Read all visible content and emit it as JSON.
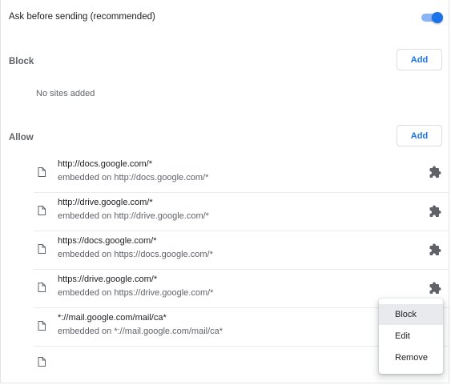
{
  "toggle_row": {
    "label": "Ask before sending (recommended)",
    "enabled": true,
    "accent_color": "#1a73e8"
  },
  "block_section": {
    "title": "Block",
    "add_label": "Add",
    "empty_text": "No sites added"
  },
  "allow_section": {
    "title": "Allow",
    "add_label": "Add",
    "sites": [
      {
        "url": "http://docs.google.com/*",
        "embedded": "embedded on http://docs.google.com/*",
        "icon": "file-icon",
        "extension_icon": "puzzle-icon"
      },
      {
        "url": "http://drive.google.com/*",
        "embedded": "embedded on http://drive.google.com/*",
        "icon": "file-icon",
        "extension_icon": "puzzle-icon"
      },
      {
        "url": "https://docs.google.com/*",
        "embedded": "embedded on https://docs.google.com/*",
        "icon": "file-icon",
        "extension_icon": "puzzle-icon"
      },
      {
        "url": "https://drive.google.com/*",
        "embedded": "embedded on https://drive.google.com/*",
        "icon": "file-icon",
        "extension_icon": "puzzle-icon"
      },
      {
        "url": "*://mail.google.com/mail/ca*",
        "embedded": "embedded on *://mail.google.com/mail/ca*",
        "icon": "file-icon",
        "extension_icon": ""
      },
      {
        "url": "",
        "embedded": "",
        "icon": "file-icon",
        "extension_icon": ""
      }
    ]
  },
  "context_menu": {
    "items": [
      "Block",
      "Edit",
      "Remove"
    ],
    "highlighted": "Block"
  }
}
